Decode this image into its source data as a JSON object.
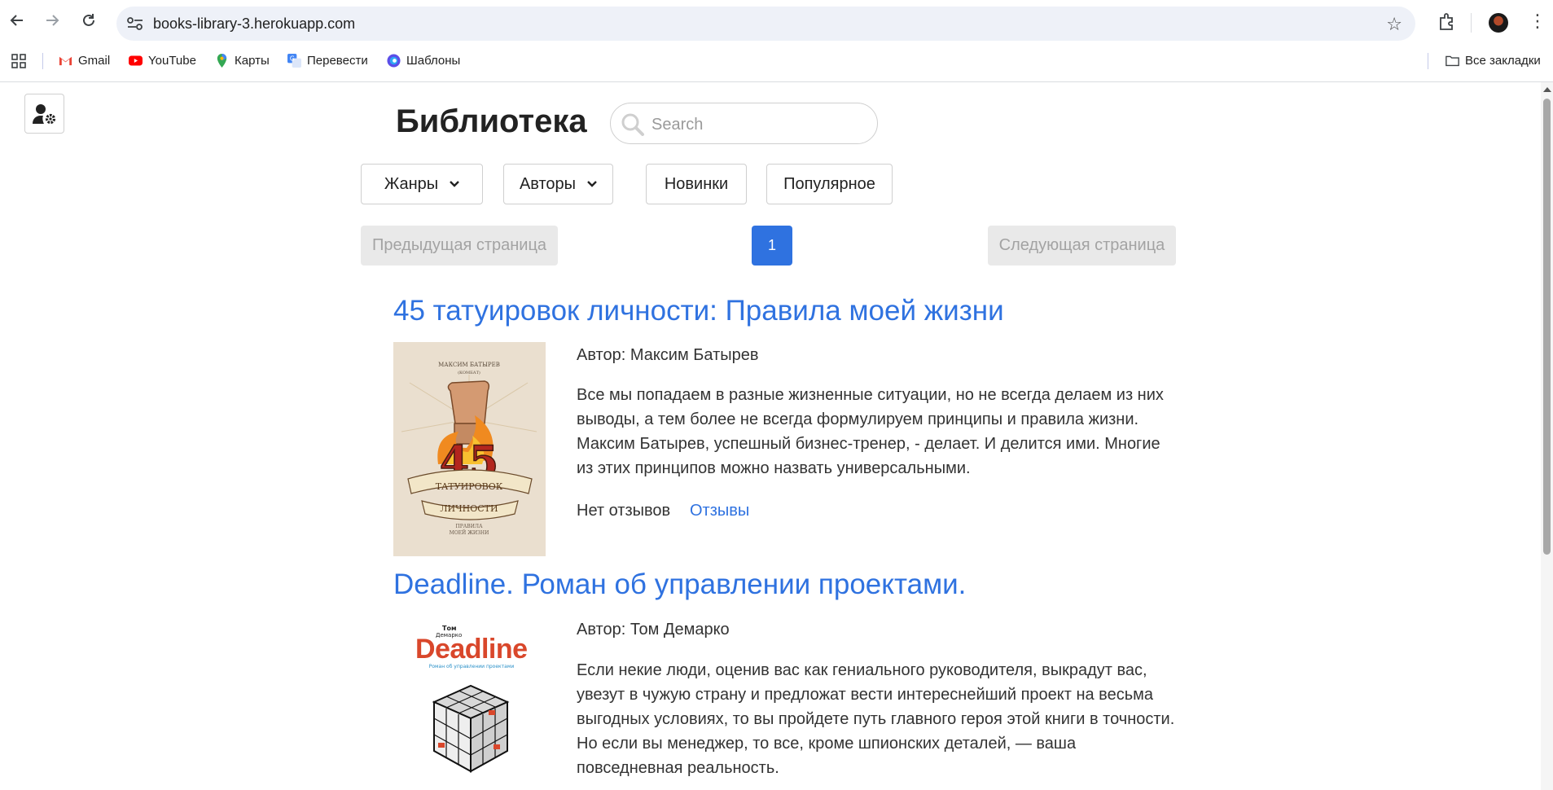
{
  "browser": {
    "url": "books-library-3.herokuapp.com",
    "bookmarks": [
      {
        "label": "Gmail",
        "icon": "gmail-icon"
      },
      {
        "label": "YouTube",
        "icon": "youtube-icon"
      },
      {
        "label": "Карты",
        "icon": "maps-icon"
      },
      {
        "label": "Перевести",
        "icon": "translate-icon"
      },
      {
        "label": "Шаблоны",
        "icon": "templates-icon"
      }
    ],
    "all_bookmarks": "Все закладки"
  },
  "header": {
    "title": "Библиотека",
    "search_placeholder": "Search"
  },
  "menu": {
    "genres": "Жанры",
    "authors": "Авторы",
    "new": "Новинки",
    "popular": "Популярное"
  },
  "pagination": {
    "prev": "Предыдущая страница",
    "current": "1",
    "next": "Следующая страница"
  },
  "books": [
    {
      "title": "45 татуировок личности: Правила моей жизни",
      "author": "Автор: Максим Батырев",
      "description": "Все мы попадаем в разные жизненные ситуации, но не всегда делаем из них выводы, а тем более не всегда формулируем принципы и правила жизни. Максим Батырев, успешный бизнес-тренер, - делает. И делится ими. Многие из этих принципов можно назвать универсальными.",
      "reviews_status": "Нет отзывов",
      "reviews_link": "Отзывы",
      "cover": {
        "author_line": "МАКСИМ БАТЫРЕВ",
        "nickname": "(КОМБАТ)",
        "number": "45",
        "banner1": "ТАТУИРОВОК",
        "banner2": "ЛИЧНОСТИ",
        "subtitle1": "ПРАВИЛА",
        "subtitle2": "МОЕЙ ЖИЗНИ"
      }
    },
    {
      "title": "Deadline. Роман об управлении проектами.",
      "author": "Автор: Том Демарко",
      "description": "Если некие люди, оценив вас как гениального руководителя, выкрадут вас, увезут в чужую страну и предложат вести интереснейший проект на весьма выгодных условиях, то вы пройдете путь главного героя этой книги в точности. Но если вы менеджер, то все, кроме шпионских деталей, — ваша повседневная реальность.",
      "cover": {
        "author_line1": "Том",
        "author_line2": "Демарко",
        "title": "Deadline",
        "subtitle": "Роман об управлении проектами"
      }
    }
  ],
  "colors": {
    "accent": "#2f72e0",
    "text": "#333333"
  }
}
